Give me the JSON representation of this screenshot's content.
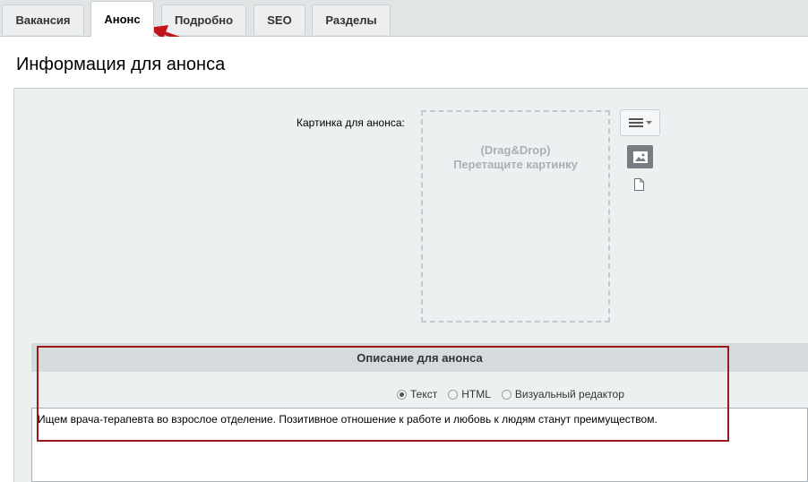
{
  "tabs": [
    {
      "label": "Вакансия",
      "active": false
    },
    {
      "label": "Анонс",
      "active": true
    },
    {
      "label": "Подробно",
      "active": false
    },
    {
      "label": "SEO",
      "active": false
    },
    {
      "label": "Разделы",
      "active": false
    }
  ],
  "section_title": "Информация для анонса",
  "preview_picture": {
    "label": "Картинка для анонса:",
    "drop_line1": "(Drag&Drop)",
    "drop_line2": "Перетащите картинку"
  },
  "description": {
    "header": "Описание для анонса",
    "modes": [
      {
        "label": "Текст",
        "checked": true
      },
      {
        "label": "HTML",
        "checked": false
      },
      {
        "label": "Визуальный редактор",
        "checked": false
      }
    ],
    "text": "Ищем врача-терапевта во взрослое отделение. Позитивное отношение к работе и любовь к людям станут преимуществом."
  },
  "icons": {
    "menu": "menu-icon",
    "dropdown": "chevron-down-icon",
    "image": "image-icon",
    "file": "file-icon"
  },
  "colors": {
    "annotation": "#9c1a1a",
    "arrow": "#c0151b",
    "tabbar": "#e1e5e6",
    "panel": "#edf0f1",
    "header": "#d5dbdd"
  }
}
